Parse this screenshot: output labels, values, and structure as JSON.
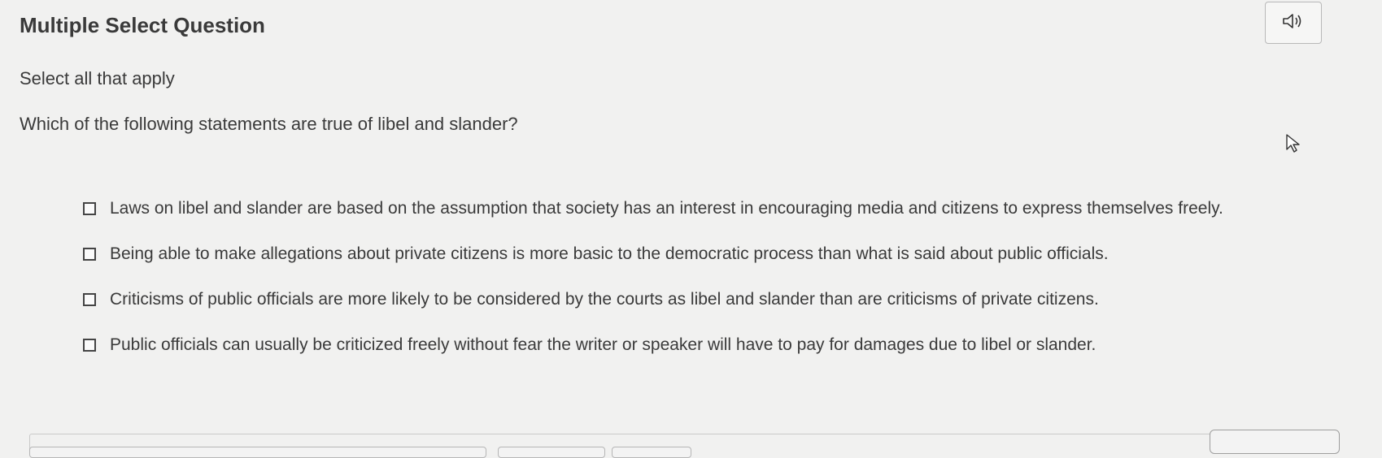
{
  "question": {
    "type_label": "Multiple Select Question",
    "instruction": "Select all that apply",
    "prompt": "Which of the following statements are true of libel and slander?",
    "options": [
      {
        "text": "Laws on libel and slander are based on the assumption that society has an interest in encouraging media and citizens to express themselves freely.",
        "checked": false
      },
      {
        "text": "Being able to make allegations about private citizens is more basic to the democratic process than what is said about public officials.",
        "checked": false
      },
      {
        "text": "Criticisms of public officials are more likely to be considered by the courts as libel and slander than are criticisms of private citizens.",
        "checked": false
      },
      {
        "text": "Public officials can usually be criticized freely without fear the writer or speaker will have to pay for damages due to libel or slander.",
        "checked": false
      }
    ]
  },
  "toolbar": {
    "audio_icon": "speaker-icon"
  },
  "colors": {
    "background": "#f1f1f0",
    "text": "#3a3a3a",
    "checkbox_border": "#444444"
  }
}
